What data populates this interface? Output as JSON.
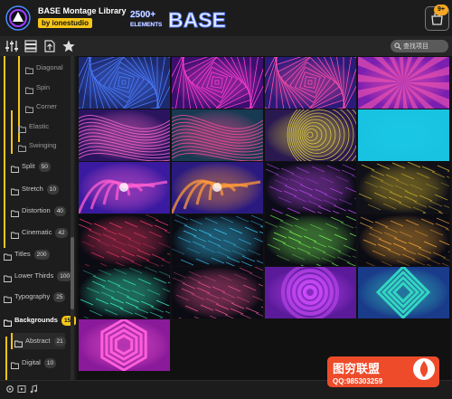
{
  "app": {
    "title": "BASE Montage Library",
    "byline": "by ionestudio",
    "banner_count": "2500+",
    "banner_unit": "ELEMENTS",
    "banner_word": "BASE"
  },
  "cart": {
    "badge": "9+"
  },
  "toolbar": {
    "tools": [
      "sliders-icon",
      "list-icon",
      "export-icon",
      "favorites-star-icon"
    ],
    "search_placeholder": "查找项目"
  },
  "sidebar": {
    "items": [
      {
        "label": "Diagonal",
        "count": ""
      },
      {
        "label": "Spin",
        "count": ""
      },
      {
        "label": "Corner",
        "count": ""
      },
      {
        "label": "Elastic",
        "count": ""
      },
      {
        "label": "Swinging",
        "count": ""
      },
      {
        "label": "Split",
        "count": "50"
      },
      {
        "label": "Stretch",
        "count": "10"
      },
      {
        "label": "Distortion",
        "count": "40"
      },
      {
        "label": "Cinematic",
        "count": "42"
      },
      {
        "label": "Titles",
        "count": "200"
      },
      {
        "label": "Lower Thirds",
        "count": "100"
      },
      {
        "label": "Typography",
        "count": "25"
      },
      {
        "label": "Backgrounds",
        "count": "150"
      },
      {
        "label": "Abstract",
        "count": "21"
      },
      {
        "label": "Digital",
        "count": "10"
      }
    ]
  },
  "thumbnails": [
    {
      "style": "spiral-squares",
      "colors": [
        "#1e2a6e",
        "#4a7cff"
      ]
    },
    {
      "style": "spiral-squares",
      "colors": [
        "#3a0f6e",
        "#ff3fd2"
      ]
    },
    {
      "style": "spiral-squares",
      "colors": [
        "#2a1a7a",
        "#ff4fa8"
      ]
    },
    {
      "style": "rays",
      "colors": [
        "#7a1fb0",
        "#ff5ab0"
      ]
    },
    {
      "style": "waves",
      "colors": [
        "#2a1460",
        "#ff6ac8"
      ]
    },
    {
      "style": "waves",
      "colors": [
        "#173a52",
        "#ff4b9a"
      ]
    },
    {
      "style": "tunnel",
      "colors": [
        "#2a1850",
        "#f5e642"
      ]
    },
    {
      "style": "plain",
      "colors": [
        "#12b5d6",
        "#1ccbe8"
      ]
    },
    {
      "style": "swirl",
      "colors": [
        "#3a1aa0",
        "#ff5fd0"
      ]
    },
    {
      "style": "swirl",
      "colors": [
        "#2a1a80",
        "#ff9a3a"
      ]
    },
    {
      "style": "streaks",
      "colors": [
        "#0c0c18",
        "#c84cff"
      ]
    },
    {
      "style": "streaks",
      "colors": [
        "#101018",
        "#e0c030"
      ]
    },
    {
      "style": "streaks",
      "colors": [
        "#0b0b14",
        "#ff3a6a"
      ]
    },
    {
      "style": "streaks",
      "colors": [
        "#0b0b14",
        "#3ad0ff"
      ]
    },
    {
      "style": "streaks",
      "colors": [
        "#0b0b14",
        "#7cff5a"
      ]
    },
    {
      "style": "streaks",
      "colors": [
        "#0b0b14",
        "#ffb03a"
      ]
    },
    {
      "style": "streaks",
      "colors": [
        "#0b0b14",
        "#3affc8"
      ]
    },
    {
      "style": "streaks",
      "colors": [
        "#0b0b14",
        "#ff5aa0"
      ]
    },
    {
      "style": "rings",
      "colors": [
        "#5a1a9a",
        "#d24cff"
      ]
    },
    {
      "style": "diamond",
      "colors": [
        "#1a3a8a",
        "#33d6c0"
      ]
    },
    {
      "style": "hexagon",
      "colors": [
        "#8a1a9a",
        "#ff5fd8"
      ]
    }
  ],
  "footer": {
    "icons": [
      "settings-icon",
      "media-icon",
      "music-icon"
    ]
  },
  "watermark": {
    "title": "图穷联盟",
    "qq": "QQ:985303259"
  },
  "colors": {
    "accent": "#f5c518",
    "sidebar_bg": "#1d1d1d",
    "header_bg": "#1c1c1c"
  }
}
